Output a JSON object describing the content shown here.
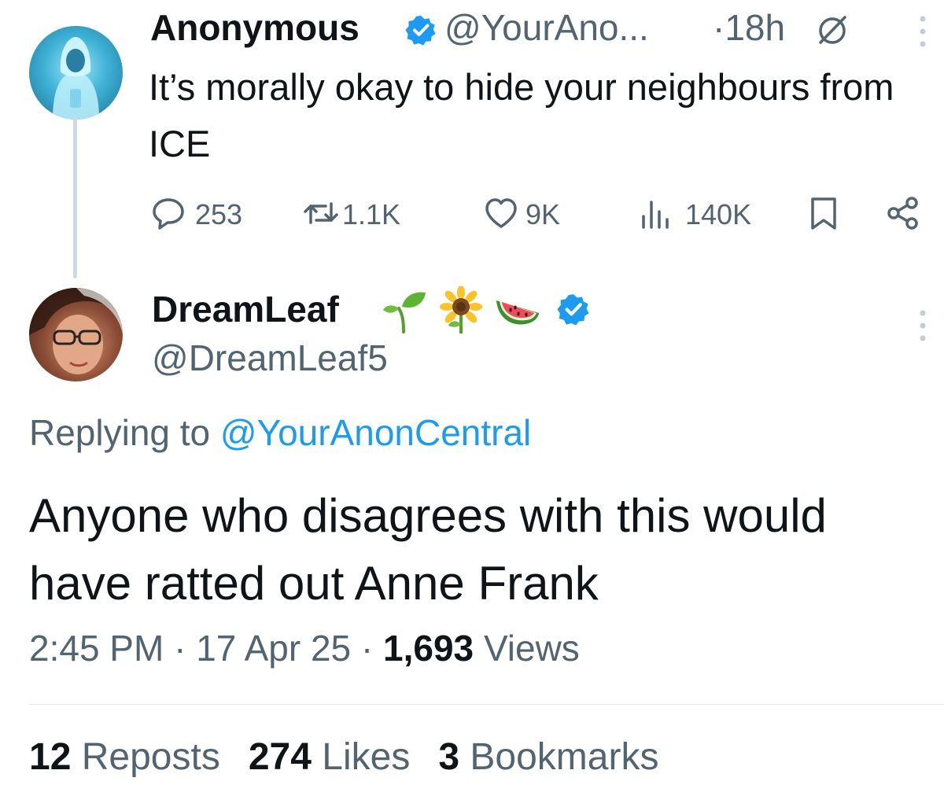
{
  "parent_tweet": {
    "author_name": "Anonymous",
    "handle": "@YourAno...",
    "time": "·18h",
    "text": "It’s morally okay to hide your neighbours from ICE",
    "actions": {
      "replies": "253",
      "reposts": "1.1K",
      "likes": "9K",
      "views": "140K"
    },
    "icons": [
      "verified-badge-icon",
      "grok-icon",
      "more-icon",
      "reply-icon",
      "repost-icon",
      "like-icon",
      "views-icon",
      "bookmark-icon",
      "share-icon"
    ]
  },
  "reply_tweet": {
    "author_name": "DreamLeaf",
    "name_emojis": [
      "seedling-emoji",
      "sunflower-emoji",
      "watermelon-emoji"
    ],
    "handle": "@DreamLeaf5",
    "replying_prefix": "Replying to",
    "replying_handle": "@YourAnonCentral",
    "text": "Anyone who disagrees with this would have ratted out Anne Frank",
    "time": "2:45 PM",
    "date": "17 Apr 25",
    "views_count": "1,693",
    "views_label": "Views",
    "reposts_count": "12",
    "reposts_label": "Reposts",
    "likes_count": "274",
    "likes_label": "Likes",
    "bookmarks_count": "3",
    "bookmarks_label": "Bookmarks"
  },
  "colors": {
    "text": "#0f1419",
    "secondary": "#536471",
    "link": "#1d9bf0",
    "verified": "#1d9bf0",
    "thread_line": "#cfd9de"
  }
}
